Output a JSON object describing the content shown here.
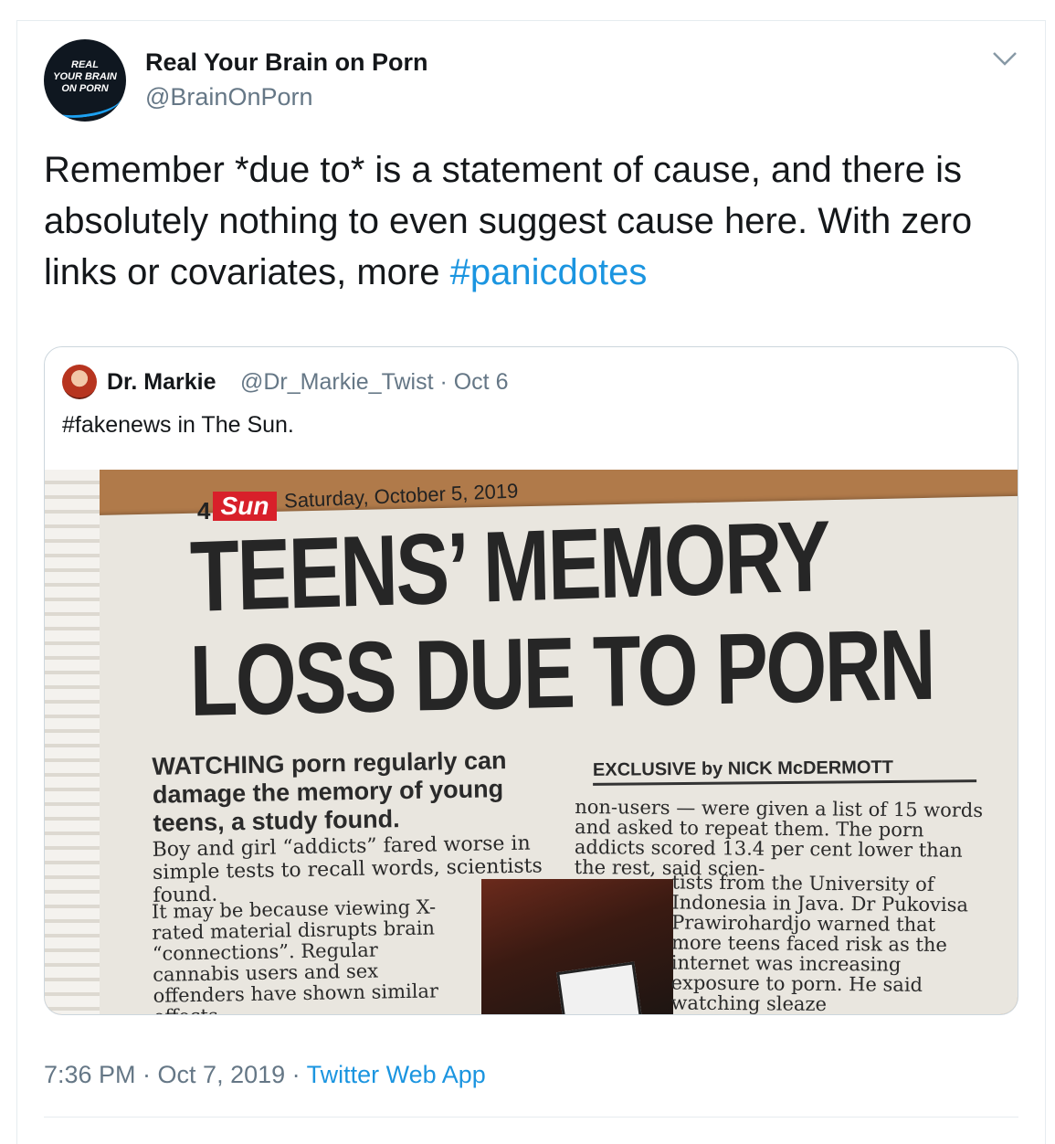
{
  "tweet": {
    "author": {
      "name": "Real Your Brain on Porn",
      "handle": "@BrainOnPorn",
      "avatar_text": [
        "REAL",
        "YOUR BRAIN",
        "ON PORN"
      ]
    },
    "menu_icon": "chevron-down-icon",
    "text_main": "Remember *due to* is a statement of cause, and there is absolutely nothing to even suggest cause here. With zero links or covariates, more ",
    "hashtag": "#panicdotes",
    "timestamp": "7:36 PM · Oct 7, 2019 · ",
    "source": "Twitter Web App"
  },
  "quoted_tweet": {
    "name": "Dr. Markie",
    "handle_date": "@Dr_Markie_Twist · Oct 6",
    "text": "#fakenews in The Sun."
  },
  "newspaper": {
    "page": "4",
    "masthead": "Sun",
    "date": "Saturday, October 5, 2019",
    "headline_1": "TEENS’ MEMORY",
    "headline_2": "LOSS DUE TO PORN",
    "lede": "WATCHING porn regularly can damage the memory of young teens, a study found.",
    "body_1": "Boy and girl “addicts” fared worse in simple tests to recall words, scientists found.",
    "body_2": "It may be because viewing X-rated material disrupts brain “connections”. Regular cannabis users and sex offenders have shown similar effects.",
    "byline": "EXCLUSIVE by NICK McDERMOTT",
    "body_3": "non-users — were given a list of 15 words and asked to repeat them. The porn addicts scored 13.4 per cent lower than the rest, said scien-",
    "body_4": "tists from the University of Indonesia in Java. Dr Pukovisa Prawirohardjo warned that more teens faced risk as the internet was increasing exposure to porn. He said watching sleaze"
  }
}
